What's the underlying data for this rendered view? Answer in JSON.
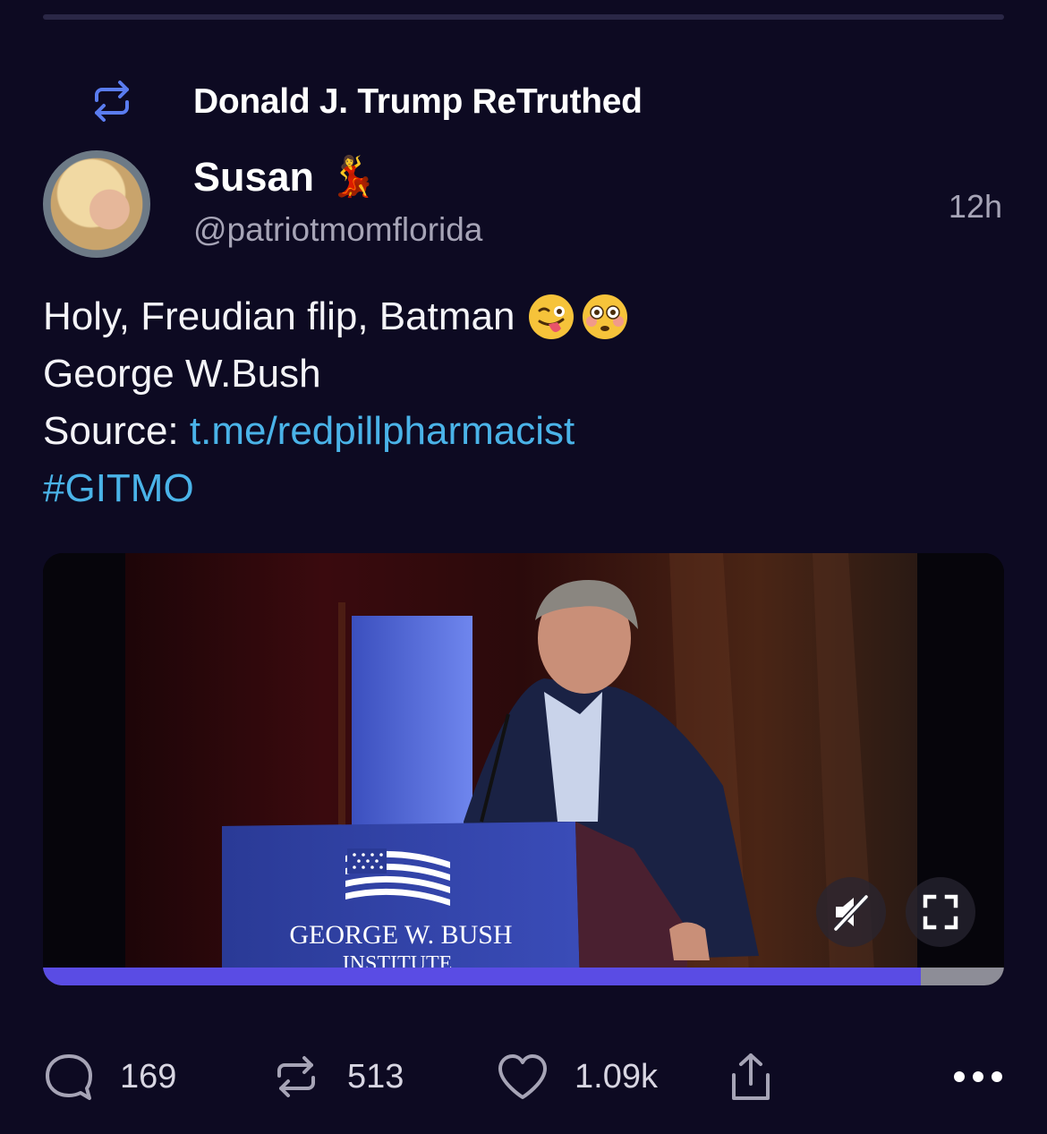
{
  "retruth": {
    "label": "Donald J. Trump ReTruthed",
    "icon": "retruth-icon"
  },
  "post": {
    "author": {
      "display_name": "Susan",
      "name_emoji": "💃",
      "handle": "@patriotmomflorida",
      "avatar": "avatar"
    },
    "timestamp": "12h",
    "body": {
      "line1": "Holy, Freudian flip, Batman",
      "line1_emojis": [
        "winking-tongue-face-icon",
        "flushed-face-icon"
      ],
      "line2": "George W.Bush",
      "line3_prefix": "Source: ",
      "line3_link": "t.me/redpillpharmacist",
      "hashtag": "#GITMO"
    },
    "media": {
      "type": "video",
      "podium_text_line1": "GEORGE W. BUSH",
      "podium_text_line2": "INSTITUTE",
      "progress_fraction": 0.913,
      "muted": true
    },
    "actions": {
      "replies": "169",
      "retruths": "513",
      "likes": "1.09k"
    }
  },
  "colors": {
    "background": "#0d0a22",
    "link": "#4ab3e8",
    "secondary_text": "#a6a4b6",
    "progress": "#5a4ce4"
  }
}
